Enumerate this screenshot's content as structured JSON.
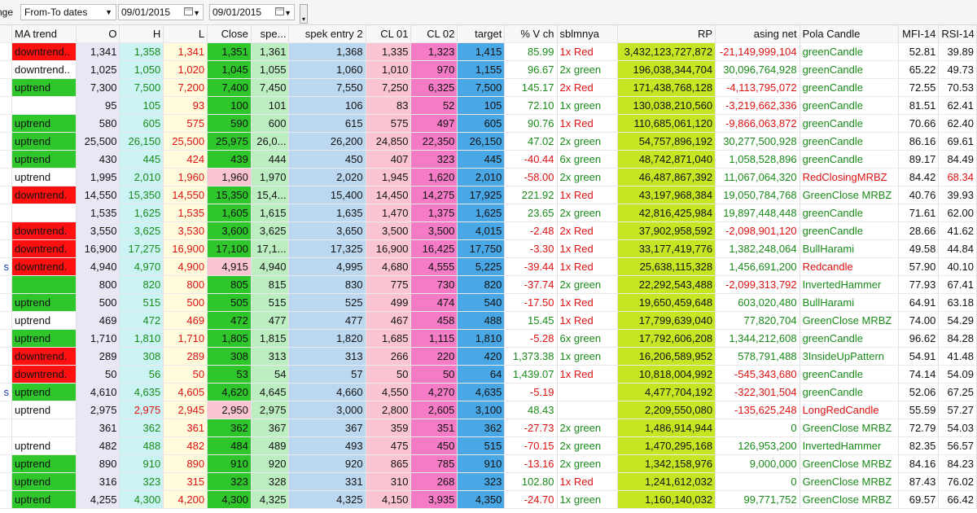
{
  "toolbar": {
    "label": "nge",
    "range_value": "From-To dates",
    "date_from": "09/01/2015",
    "date_to": "09/01/2015"
  },
  "columns": [
    "MA trend",
    "O",
    "H",
    "L",
    "Close",
    "spe...",
    "spek entry 2",
    "CL 01",
    "CL 02",
    "target",
    "% V ch",
    "sblmnya",
    "RP",
    "asing net",
    "Pola Candle",
    "MFI-14",
    "RSI-14"
  ],
  "rows": [
    {
      "side": "",
      "ma": "downtrend",
      "ma_text": "downtrend..",
      "o": "1,341",
      "h": "1,358",
      "l": "1,341",
      "close": "1,351",
      "close_bg": "green",
      "spe": "1,361",
      "spe_bg": "green",
      "spek2": "1,368",
      "cl1": "1,335",
      "cl2": "1,323",
      "target": "1,415",
      "vch": "85.99",
      "sbl": "1x Red",
      "rp": "3,432,123,727,872",
      "asing": "-21,149,999,104",
      "pola": "greenCandle",
      "mfi": "52.81",
      "rsi": "39.89"
    },
    {
      "side": "",
      "ma": "",
      "ma_text": "downtrend..",
      "o": "1,025",
      "h": "1,050",
      "l": "1,020",
      "close": "1,045",
      "close_bg": "green",
      "spe": "1,055",
      "spe_bg": "green",
      "spek2": "1,060",
      "cl1": "1,010",
      "cl2": "970",
      "target": "1,155",
      "vch": "96.67",
      "sbl": "2x green",
      "rp": "196,038,344,704",
      "asing": "30,096,764,928",
      "pola": "greenCandle",
      "mfi": "65.22",
      "rsi": "49.73"
    },
    {
      "side": "",
      "ma": "uptrend",
      "ma_text": "uptrend",
      "o": "7,300",
      "h": "7,500",
      "l": "7,200",
      "close": "7,400",
      "close_bg": "green",
      "spe": "7,450",
      "spe_bg": "green",
      "spek2": "7,550",
      "cl1": "7,250",
      "cl2": "6,325",
      "target": "7,500",
      "vch": "145.17",
      "sbl": "2x Red",
      "rp": "171,438,768,128",
      "asing": "-4,113,795,072",
      "pola": "greenCandle",
      "mfi": "72.55",
      "rsi": "70.53"
    },
    {
      "side": "",
      "ma": "",
      "ma_text": "",
      "o": "95",
      "h": "105",
      "l": "93",
      "close": "100",
      "close_bg": "green",
      "spe": "101",
      "spe_bg": "green",
      "spek2": "106",
      "cl1": "83",
      "cl2": "52",
      "target": "105",
      "vch": "72.10",
      "sbl": "1x green",
      "rp": "130,038,210,560",
      "asing": "-3,219,662,336",
      "pola": "greenCandle",
      "mfi": "81.51",
      "rsi": "62.41"
    },
    {
      "side": "",
      "ma": "uptrend",
      "ma_text": "uptrend",
      "o": "580",
      "h": "605",
      "l": "575",
      "close": "590",
      "close_bg": "green",
      "spe": "600",
      "spe_bg": "green",
      "spek2": "615",
      "cl1": "575",
      "cl2": "497",
      "target": "605",
      "vch": "90.76",
      "sbl": "1x Red",
      "rp": "110,685,061,120",
      "asing": "-9,866,063,872",
      "pola": "greenCandle",
      "mfi": "70.66",
      "rsi": "62.40"
    },
    {
      "side": "",
      "ma": "uptrend",
      "ma_text": "uptrend",
      "o": "25,500",
      "h": "26,150",
      "l": "25,500",
      "close": "25,975",
      "close_bg": "green",
      "spe": "26,0...",
      "spe_bg": "green",
      "spek2": "26,200",
      "cl1": "24,850",
      "cl2": "22,350",
      "target": "26,150",
      "vch": "47.02",
      "sbl": "2x green",
      "rp": "54,757,896,192",
      "asing": "30,277,500,928",
      "pola": "greenCandle",
      "mfi": "86.16",
      "rsi": "69.61"
    },
    {
      "side": "",
      "ma": "uptrend",
      "ma_text": "uptrend",
      "o": "430",
      "h": "445",
      "l": "424",
      "close": "439",
      "close_bg": "green",
      "spe": "444",
      "spe_bg": "green",
      "spek2": "450",
      "cl1": "407",
      "cl2": "323",
      "target": "445",
      "vch": "-40.44",
      "sbl": "6x green",
      "rp": "48,742,871,040",
      "asing": "1,058,528,896",
      "pola": "greenCandle",
      "mfi": "89.17",
      "rsi": "84.49"
    },
    {
      "side": "",
      "ma": "",
      "ma_text": "uptrend",
      "o": "1,995",
      "h": "2,010",
      "l": "1,960",
      "close": "1,960",
      "close_bg": "pink",
      "spe": "1,970",
      "spe_bg": "green",
      "spek2": "2,020",
      "cl1": "1,945",
      "cl2": "1,620",
      "target": "2,010",
      "vch": "-58.00",
      "sbl": "2x green",
      "rp": "46,487,867,392",
      "asing": "11,067,064,320",
      "pola": "RedClosingMRBZ",
      "mfi": "84.42",
      "rsi": "68.34"
    },
    {
      "side": "",
      "ma": "downtrend",
      "ma_text": "downtrend.",
      "o": "14,550",
      "h": "15,350",
      "l": "14,550",
      "close": "15,350",
      "close_bg": "green",
      "spe": "15,4...",
      "spe_bg": "green",
      "spek2": "15,400",
      "cl1": "14,450",
      "cl2": "14,275",
      "target": "17,925",
      "vch": "221.92",
      "sbl": "1x Red",
      "rp": "43,197,968,384",
      "asing": "19,050,784,768",
      "pola": "GreenClose MRBZ",
      "mfi": "40.76",
      "rsi": "39.93"
    },
    {
      "side": "",
      "ma": "",
      "ma_text": "",
      "o": "1,535",
      "h": "1,625",
      "l": "1,535",
      "close": "1,605",
      "close_bg": "green",
      "spe": "1,615",
      "spe_bg": "green",
      "spek2": "1,635",
      "cl1": "1,470",
      "cl2": "1,375",
      "target": "1,625",
      "vch": "23.65",
      "sbl": "2x green",
      "rp": "42,816,425,984",
      "asing": "19,897,448,448",
      "pola": "greenCandle",
      "mfi": "71.61",
      "rsi": "62.00"
    },
    {
      "side": "",
      "ma": "downtrend",
      "ma_text": "downtrend.",
      "o": "3,550",
      "h": "3,625",
      "l": "3,530",
      "close": "3,600",
      "close_bg": "green",
      "spe": "3,625",
      "spe_bg": "green",
      "spek2": "3,650",
      "cl1": "3,500",
      "cl2": "3,500",
      "target": "4,015",
      "vch": "-2.48",
      "sbl": "2x Red",
      "rp": "37,902,958,592",
      "asing": "-2,098,901,120",
      "pola": "greenCandle",
      "mfi": "28.66",
      "rsi": "41.62"
    },
    {
      "side": "",
      "ma": "downtrend",
      "ma_text": "downtrend.",
      "o": "16,900",
      "h": "17,275",
      "l": "16,900",
      "close": "17,100",
      "close_bg": "green",
      "spe": "17,1...",
      "spe_bg": "green",
      "spek2": "17,325",
      "cl1": "16,900",
      "cl2": "16,425",
      "target": "17,750",
      "vch": "-3.30",
      "sbl": "1x Red",
      "rp": "33,177,419,776",
      "asing": "1,382,248,064",
      "pola": "BullHarami",
      "mfi": "49.58",
      "rsi": "44.84"
    },
    {
      "side": "s",
      "ma": "downtrend",
      "ma_text": "downtrend.",
      "o": "4,940",
      "h": "4,970",
      "l": "4,900",
      "close": "4,915",
      "close_bg": "pink",
      "spe": "4,940",
      "spe_bg": "green",
      "spek2": "4,995",
      "cl1": "4,680",
      "cl2": "4,555",
      "target": "5,225",
      "vch": "-39.44",
      "sbl": "1x Red",
      "rp": "25,638,115,328",
      "asing": "1,456,691,200",
      "pola": "Redcandle",
      "mfi": "57.90",
      "rsi": "40.10"
    },
    {
      "side": "",
      "ma": "uptrend",
      "ma_text": "",
      "o": "800",
      "h": "820",
      "l": "800",
      "close": "805",
      "close_bg": "green",
      "spe": "815",
      "spe_bg": "green",
      "spek2": "830",
      "cl1": "775",
      "cl2": "730",
      "target": "820",
      "vch": "-37.74",
      "sbl": "2x green",
      "rp": "22,292,543,488",
      "asing": "-2,099,313,792",
      "pola": "InvertedHammer",
      "mfi": "77.93",
      "rsi": "67.41"
    },
    {
      "side": "",
      "ma": "uptrend",
      "ma_text": "uptrend",
      "o": "500",
      "h": "515",
      "l": "500",
      "close": "505",
      "close_bg": "green",
      "spe": "515",
      "spe_bg": "green",
      "spek2": "525",
      "cl1": "499",
      "cl2": "474",
      "target": "540",
      "vch": "-17.50",
      "sbl": "1x Red",
      "rp": "19,650,459,648",
      "asing": "603,020,480",
      "pola": "BullHarami",
      "mfi": "64.91",
      "rsi": "63.18"
    },
    {
      "side": "",
      "ma": "",
      "ma_text": "uptrend",
      "o": "469",
      "h": "472",
      "l": "469",
      "close": "472",
      "close_bg": "green",
      "spe": "477",
      "spe_bg": "green",
      "spek2": "477",
      "cl1": "467",
      "cl2": "458",
      "target": "488",
      "vch": "15.45",
      "sbl": "1x Red",
      "rp": "17,799,639,040",
      "asing": "77,820,704",
      "pola": "GreenClose MRBZ",
      "mfi": "74.00",
      "rsi": "54.29"
    },
    {
      "side": "",
      "ma": "uptrend",
      "ma_text": "uptrend",
      "o": "1,710",
      "h": "1,810",
      "l": "1,710",
      "close": "1,805",
      "close_bg": "green",
      "spe": "1,815",
      "spe_bg": "green",
      "spek2": "1,820",
      "cl1": "1,685",
      "cl2": "1,115",
      "target": "1,810",
      "vch": "-5.28",
      "sbl": "6x green",
      "rp": "17,792,606,208",
      "asing": "1,344,212,608",
      "pola": "greenCandle",
      "mfi": "96.62",
      "rsi": "84.28"
    },
    {
      "side": "",
      "ma": "downtrend",
      "ma_text": "downtrend.",
      "o": "289",
      "h": "308",
      "l": "289",
      "close": "308",
      "close_bg": "green",
      "spe": "313",
      "spe_bg": "green",
      "spek2": "313",
      "cl1": "266",
      "cl2": "220",
      "target": "420",
      "vch": "1,373.38",
      "sbl": "1x green",
      "rp": "16,206,589,952",
      "asing": "578,791,488",
      "pola": "3InsideUpPattern",
      "mfi": "54.91",
      "rsi": "41.48"
    },
    {
      "side": "",
      "ma": "downtrend",
      "ma_text": "downtrend.",
      "o": "50",
      "h": "56",
      "l": "50",
      "close": "53",
      "close_bg": "green",
      "spe": "54",
      "spe_bg": "green",
      "spek2": "57",
      "cl1": "50",
      "cl2": "50",
      "target": "64",
      "vch": "1,439.07",
      "sbl": "1x Red",
      "rp": "10,818,004,992",
      "asing": "-545,343,680",
      "pola": "greenCandle",
      "mfi": "74.14",
      "rsi": "54.09"
    },
    {
      "side": "s",
      "ma": "uptrend",
      "ma_text": "uptrend",
      "o": "4,610",
      "h": "4,635",
      "l": "4,605",
      "close": "4,620",
      "close_bg": "green",
      "spe": "4,645",
      "spe_bg": "green",
      "spek2": "4,660",
      "cl1": "4,550",
      "cl2": "4,270",
      "target": "4,635",
      "vch": "-5.19",
      "sbl": "",
      "rp": "4,477,704,192",
      "asing": "-322,301,504",
      "pola": "greenCandle",
      "mfi": "52.06",
      "rsi": "67.25"
    },
    {
      "side": "",
      "ma": "",
      "ma_text": "uptrend",
      "o": "2,975",
      "h": "2,975",
      "l": "2,945",
      "close": "2,950",
      "close_bg": "pink",
      "spe": "2,975",
      "spe_bg": "green",
      "spek2": "3,000",
      "cl1": "2,800",
      "cl2": "2,605",
      "target": "3,100",
      "vch": "48.43",
      "sbl": "",
      "rp": "2,209,550,080",
      "asing": "-135,625,248",
      "pola": "LongRedCandle",
      "mfi": "55.59",
      "rsi": "57.27"
    },
    {
      "side": "",
      "ma": "",
      "ma_text": "",
      "o": "361",
      "h": "362",
      "l": "361",
      "close": "362",
      "close_bg": "green",
      "spe": "367",
      "spe_bg": "green",
      "spek2": "367",
      "cl1": "359",
      "cl2": "351",
      "target": "362",
      "vch": "-27.73",
      "sbl": "2x green",
      "rp": "1,486,914,944",
      "asing": "0",
      "pola": "GreenClose MRBZ",
      "mfi": "72.79",
      "rsi": "54.03"
    },
    {
      "side": "",
      "ma": "",
      "ma_text": "uptrend",
      "o": "482",
      "h": "488",
      "l": "482",
      "close": "484",
      "close_bg": "green",
      "spe": "489",
      "spe_bg": "green",
      "spek2": "493",
      "cl1": "475",
      "cl2": "450",
      "target": "515",
      "vch": "-70.15",
      "sbl": "2x green",
      "rp": "1,470,295,168",
      "asing": "126,953,200",
      "pola": "InvertedHammer",
      "mfi": "82.35",
      "rsi": "56.57"
    },
    {
      "side": "",
      "ma": "uptrend",
      "ma_text": "uptrend",
      "o": "890",
      "h": "910",
      "l": "890",
      "close": "910",
      "close_bg": "green",
      "spe": "920",
      "spe_bg": "green",
      "spek2": "920",
      "cl1": "865",
      "cl2": "785",
      "target": "910",
      "vch": "-13.16",
      "sbl": "2x green",
      "rp": "1,342,158,976",
      "asing": "9,000,000",
      "pola": "GreenClose MRBZ",
      "mfi": "84.16",
      "rsi": "84.23"
    },
    {
      "side": "",
      "ma": "uptrend",
      "ma_text": "uptrend",
      "o": "316",
      "h": "323",
      "l": "315",
      "close": "323",
      "close_bg": "green",
      "spe": "328",
      "spe_bg": "green",
      "spek2": "331",
      "cl1": "310",
      "cl2": "268",
      "target": "323",
      "vch": "102.80",
      "sbl": "1x Red",
      "rp": "1,241,612,032",
      "asing": "0",
      "pola": "GreenClose MRBZ",
      "mfi": "87.43",
      "rsi": "76.02"
    },
    {
      "side": "",
      "ma": "uptrend",
      "ma_text": "uptrend",
      "o": "4,255",
      "h": "4,300",
      "l": "4,200",
      "close": "4,300",
      "close_bg": "green",
      "spe": "4,325",
      "spe_bg": "green",
      "spek2": "4,325",
      "cl1": "4,150",
      "cl2": "3,935",
      "target": "4,350",
      "vch": "-24.70",
      "sbl": "1x green",
      "rp": "1,160,140,032",
      "asing": "99,771,752",
      "pola": "GreenClose MRBZ",
      "mfi": "69.57",
      "rsi": "66.42"
    }
  ]
}
